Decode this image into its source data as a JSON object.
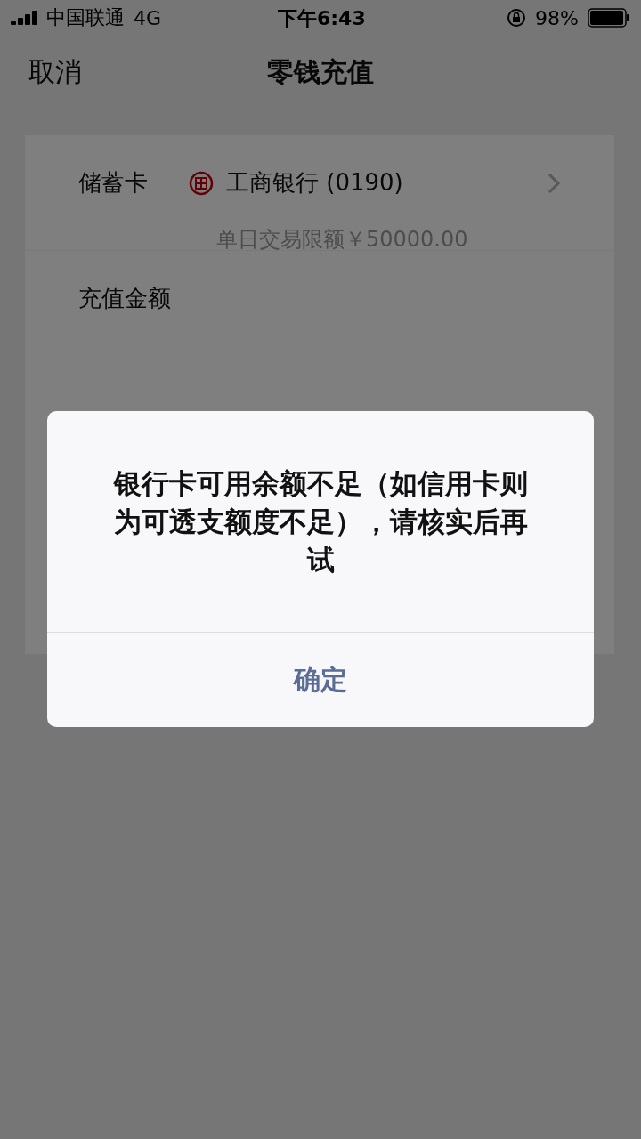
{
  "status_bar": {
    "carrier": "中国联通",
    "network": "4G",
    "time": "下午6:43",
    "battery_text": "98%"
  },
  "nav": {
    "cancel": "取消",
    "title": "零钱充值"
  },
  "card": {
    "label": "储蓄卡",
    "bank": "工商银行 (0190)",
    "limit": "单日交易限额￥50000.00"
  },
  "amount": {
    "label": "充值金额"
  },
  "dialog": {
    "message": "银行卡可用余额不足（如信用卡则为可透支额度不足），请核实后再试",
    "button": "确定"
  }
}
